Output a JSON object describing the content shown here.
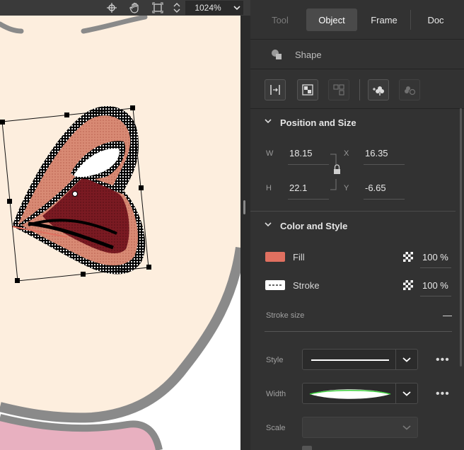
{
  "toolbar": {
    "zoom_value": "1024%",
    "icons": [
      "crosshair-icon",
      "hand-icon",
      "fit-frame-icon",
      "zoom-stepper-icon",
      "dropdown-chevron-icon"
    ]
  },
  "panel": {
    "tabs": [
      {
        "label": "Tool",
        "state": "disabled"
      },
      {
        "label": "Object",
        "state": "active"
      },
      {
        "label": "Frame",
        "state": "normal"
      },
      {
        "label": "Doc",
        "state": "normal"
      }
    ],
    "object_type": "Shape",
    "position_size": {
      "title": "Position and Size",
      "w_label": "W",
      "w_value": "18.15",
      "h_label": "H",
      "h_value": "22.1",
      "x_label": "X",
      "x_value": "16.35",
      "y_label": "Y",
      "y_value": "-6.65"
    },
    "color_style": {
      "title": "Color and Style",
      "fill_label": "Fill",
      "fill_color": "#e07060",
      "fill_opacity": "100 %",
      "stroke_label": "Stroke",
      "stroke_opacity": "100 %",
      "stroke_size_label": "Stroke size",
      "stroke_size_value": "—",
      "style_label": "Style",
      "width_label": "Width",
      "scale_label": "Scale",
      "more_icon": "•••"
    }
  },
  "colors": {
    "skin": "#fdeede",
    "outline_gray": "#8a8a8a",
    "lip_salmon": "#d9826f",
    "lip_dark": "#7a1a22",
    "selection_handle": "#000000",
    "panel_bg": "#323232",
    "width_profile_accent": "#3ccf3c"
  }
}
